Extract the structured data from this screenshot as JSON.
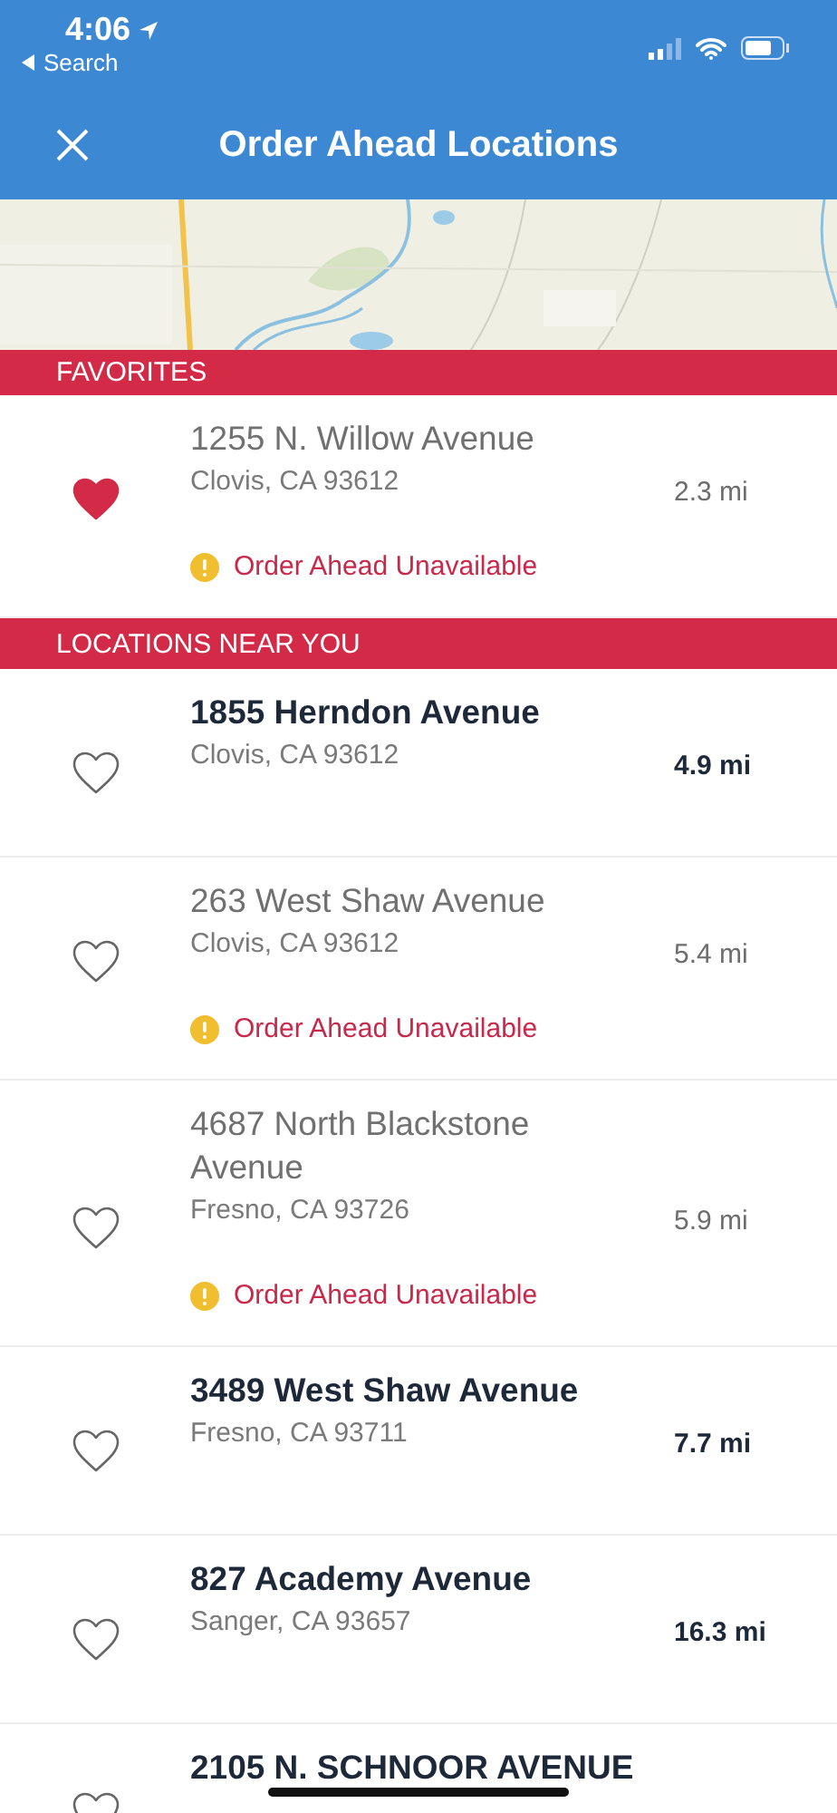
{
  "status_bar": {
    "time": "4:06",
    "back_label": "Search"
  },
  "header": {
    "title": "Order Ahead Locations"
  },
  "sections": [
    {
      "title": "FAVORITES",
      "locations": [
        {
          "name": "1255 N. Willow Avenue",
          "city": "Clovis, CA 93612",
          "distance": "2.3 mi",
          "favorite": true,
          "available": false,
          "notice": "Order Ahead Unavailable"
        }
      ]
    },
    {
      "title": "LOCATIONS NEAR YOU",
      "locations": [
        {
          "name": "1855 Herndon Avenue",
          "city": "Clovis, CA 93612",
          "distance": "4.9 mi",
          "favorite": false,
          "available": true
        },
        {
          "name": "263 West Shaw Avenue",
          "city": "Clovis, CA 93612",
          "distance": "5.4 mi",
          "favorite": false,
          "available": false,
          "notice": "Order Ahead Unavailable"
        },
        {
          "name": "4687 North Blackstone Avenue",
          "city": "Fresno, CA 93726",
          "distance": "5.9 mi",
          "favorite": false,
          "available": false,
          "notice": "Order Ahead Unavailable"
        },
        {
          "name": "3489 West Shaw Avenue",
          "city": "Fresno, CA 93711",
          "distance": "7.7 mi",
          "favorite": false,
          "available": true
        },
        {
          "name": "827 Academy Avenue",
          "city": "Sanger, CA 93657",
          "distance": "16.3 mi",
          "favorite": false,
          "available": true
        },
        {
          "name": "2105 N. SCHNOOR AVENUE",
          "favorite": false,
          "available": true
        }
      ]
    }
  ]
}
